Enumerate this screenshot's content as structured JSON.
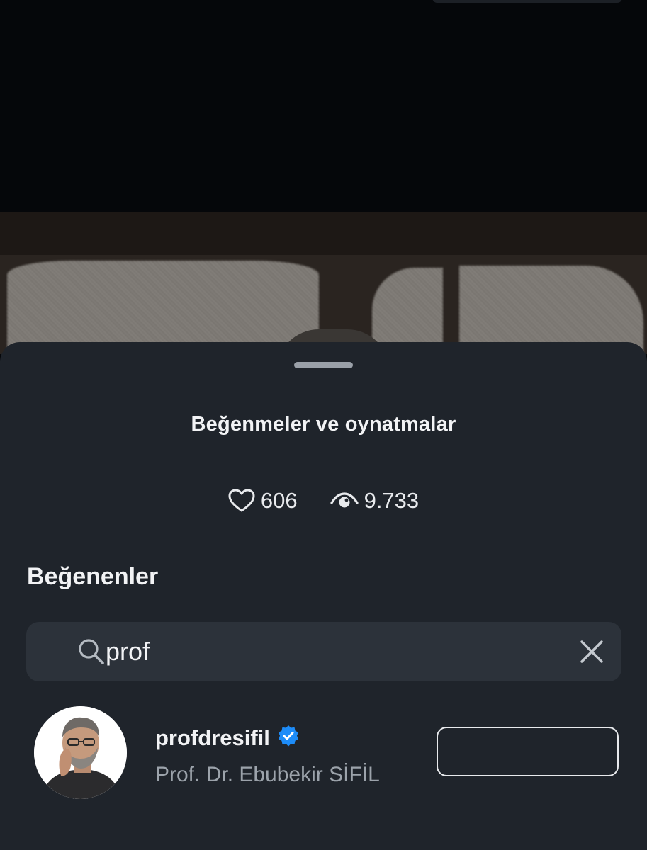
{
  "sheet": {
    "title": "Beğenmeler ve oynatmalar",
    "stats": {
      "likes": "606",
      "likes_icon": "heart-icon",
      "views": "9.733",
      "views_icon": "eye-icon"
    },
    "likers_section": {
      "title": "Beğenenler"
    },
    "search": {
      "value": "prof",
      "search_icon": "search-icon",
      "clear_icon": "close-icon"
    },
    "results": [
      {
        "username": "profdresifil",
        "verified": true,
        "verified_icon": "verified-badge-icon",
        "full_name": "Prof. Dr. Ebubekir SİFİL",
        "button_label": ""
      }
    ]
  },
  "colors": {
    "sheet_background": "#1f242b",
    "search_background": "#2c323a",
    "verified_blue": "#1d8cf8",
    "secondary_text": "#9ca3ab"
  }
}
